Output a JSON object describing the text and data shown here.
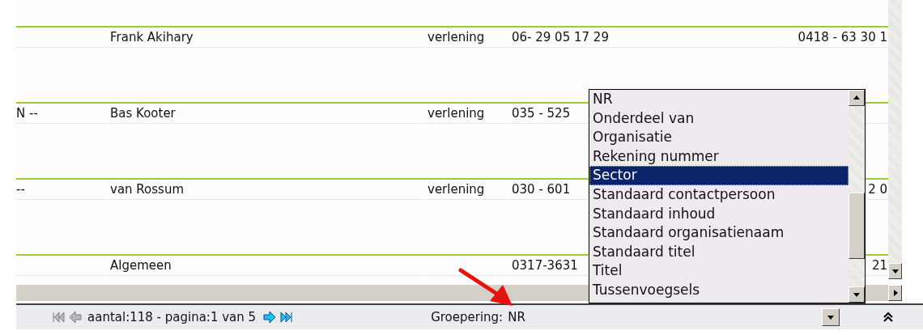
{
  "table": {
    "rows": [
      {
        "cells": [
          "",
          "Frank Akihary",
          "verlening",
          "06- 29 05 17 29",
          "0418 - 63 30 1"
        ]
      },
      {
        "cells": [
          "N --",
          "Bas Kooter",
          "verlening",
          "035 - 525",
          ""
        ]
      },
      {
        "cells": [
          "--",
          "van Rossum",
          "verlening",
          "030 - 601",
          "2 0"
        ]
      },
      {
        "cells": [
          "",
          "Algemeen",
          "",
          "0317-3631",
          "21"
        ]
      }
    ]
  },
  "group_dropdown": {
    "options": [
      {
        "label": "NR",
        "selected": false
      },
      {
        "label": "Onderdeel van",
        "selected": false
      },
      {
        "label": "Organisatie",
        "selected": false
      },
      {
        "label": "Rekening nummer",
        "selected": false
      },
      {
        "label": "Sector",
        "selected": true
      },
      {
        "label": "Standaard contactpersoon",
        "selected": false
      },
      {
        "label": "Standaard inhoud",
        "selected": false
      },
      {
        "label": "Standaard organisatienaam",
        "selected": false
      },
      {
        "label": "Standaard titel",
        "selected": false
      },
      {
        "label": "Titel",
        "selected": false
      },
      {
        "label": "Tussenvoegsels",
        "selected": false
      }
    ]
  },
  "footer": {
    "nav": [
      {
        "kind": "first",
        "disabled": true
      },
      {
        "kind": "prev",
        "disabled": true
      }
    ],
    "pager_text": "aantal:118 - pagina:1 van 5",
    "nav_next": [
      {
        "kind": "next",
        "disabled": false
      },
      {
        "kind": "last",
        "disabled": false
      }
    ],
    "grouping": {
      "label": "Groepering:",
      "value": "NR"
    }
  }
}
